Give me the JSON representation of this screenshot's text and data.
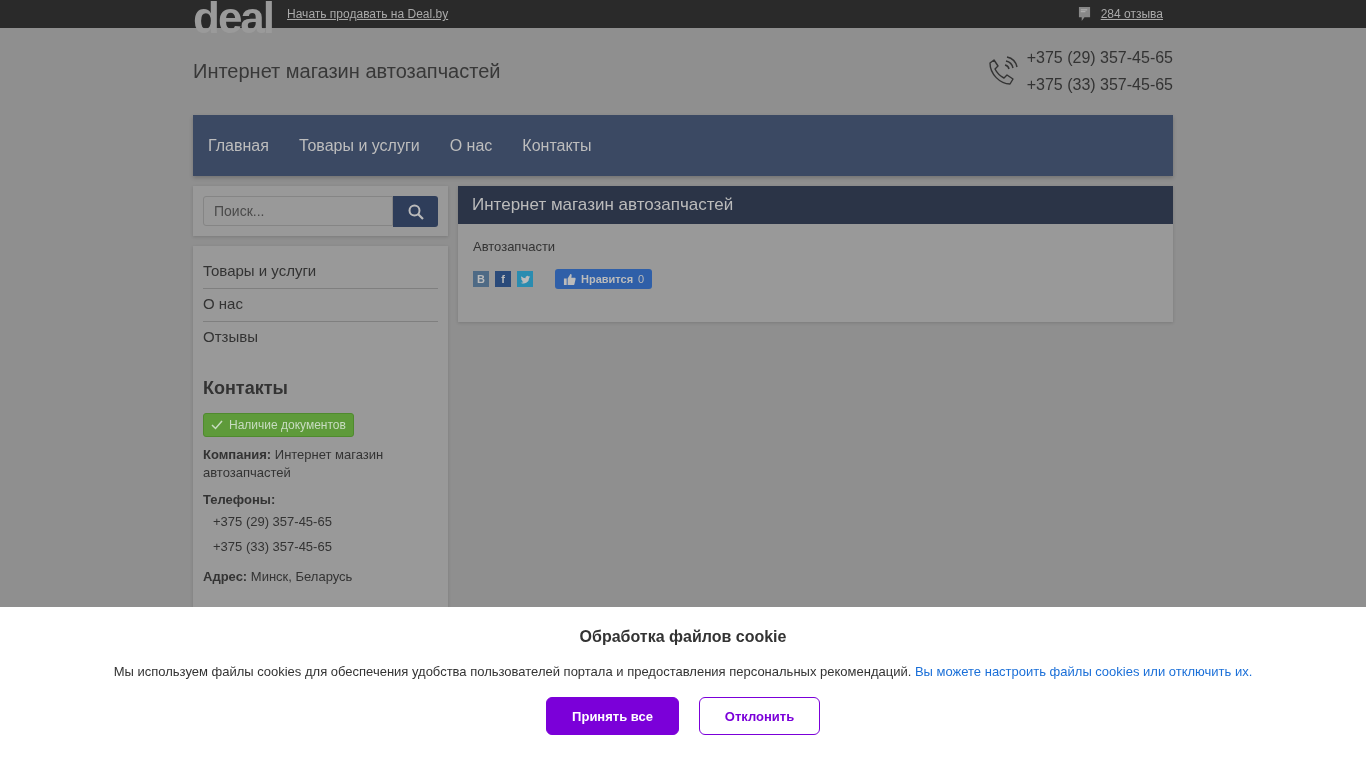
{
  "topbar": {
    "logo": "deal",
    "sell_link": "Начать продавать на Deal.by",
    "reviews_link": "284 отзыва"
  },
  "header": {
    "title": "Интернет магазин автозапчастей",
    "phones": [
      "+375 (29) 357-45-65",
      "+375 (33) 357-45-65"
    ]
  },
  "nav": [
    {
      "label": "Главная"
    },
    {
      "label": "Товары и услуги"
    },
    {
      "label": "О нас"
    },
    {
      "label": "Контакты"
    }
  ],
  "search": {
    "placeholder": "Поиск..."
  },
  "sidebar_menu": [
    {
      "label": "Товары и услуги"
    },
    {
      "label": "О нас"
    },
    {
      "label": "Отзывы"
    }
  ],
  "contacts": {
    "title": "Контакты",
    "badge": "Наличие документов",
    "company": "**Компания:** Интернет магазин автозапчастей",
    "phones_label": "Телефоны:",
    "phones": [
      "+375 (29) 357-45-65",
      "+375 (33) 357-45-65"
    ],
    "address": "**Адрес:** Минск, Беларусь"
  },
  "main": {
    "title": "Интернет магазин автозапчастей",
    "category": "Автозапчасти",
    "social": [
      {
        "kind": "vk",
        "label": "В"
      },
      {
        "kind": "facebook",
        "label": "f"
      },
      {
        "kind": "twitter"
      }
    ],
    "like": {
      "label": "Нравится",
      "count": "0"
    }
  },
  "cookie": {
    "title": "Обработка файлов cookie",
    "text": "Мы используем файлы cookies для обеспечения удобства пользователей портала и предоставления персональных рекомендаций.",
    "link": "Вы можете настроить файлы cookies или отключить их.",
    "buttons": [
      {
        "kind": "primary",
        "label": "Принять все"
      },
      {
        "kind": "secondary",
        "label": "Отклонить"
      }
    ]
  }
}
